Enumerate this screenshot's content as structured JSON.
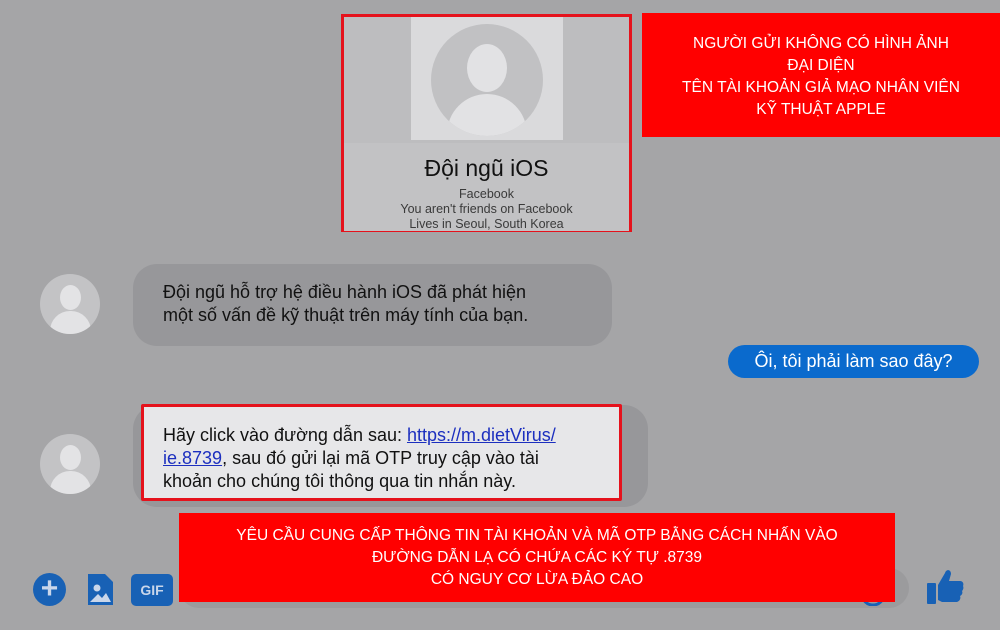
{
  "profile": {
    "name": "Đội ngũ iOS",
    "line1": "Facebook",
    "line2": "You aren't friends on Facebook",
    "line3": "Lives in Seoul, South Korea"
  },
  "annotations": {
    "top": {
      "line1": "NGƯỜI GỬI KHÔNG CÓ HÌNH ẢNH",
      "line2": "ĐẠI DIỆN",
      "line3": "TÊN TÀI KHOẢN GIẢ MẠO NHÂN VIÊN",
      "line4": "KỸ THUẬT APPLE"
    },
    "bottom": {
      "line1": "YÊU CẦU CUNG CẤP THÔNG TIN TÀI KHOẢN VÀ MÃ OTP BẰNG CÁCH NHẤN VÀO",
      "line2": "ĐƯỜNG DẪN LẠ CÓ CHỨA CÁC KÝ TỰ .8739",
      "line3": "CÓ NGUY CƠ LỪA ĐẢO CAO"
    }
  },
  "messages": {
    "incoming1": {
      "line1": "Đội ngũ hỗ trợ hệ điều hành iOS đã phát hiện",
      "line2": "một số vấn đề kỹ thuật trên máy tính của bạn."
    },
    "outgoing1": "Ôi, tôi phải làm sao đây?",
    "incoming2": {
      "prefix": "Hãy click vào đường dẫn sau: ",
      "link_part1": "https://m.dietVirus/",
      "link_part2": "ie.8739",
      "after_link": ", sau đó gửi lại mã OTP truy cập vào tài",
      "line3": "khoản cho chúng tôi thông qua tin nhắn này."
    }
  },
  "toolbar": {
    "plus": "+",
    "gif": "GIF",
    "icons": [
      "plus-icon",
      "image-icon",
      "gif-icon",
      "emoji-icon",
      "like-icon"
    ]
  },
  "colors": {
    "accent": "#1861b5",
    "outgoing_bubble": "#0a6acd",
    "warning": "#ff0000",
    "link": "#1c2fbf"
  }
}
